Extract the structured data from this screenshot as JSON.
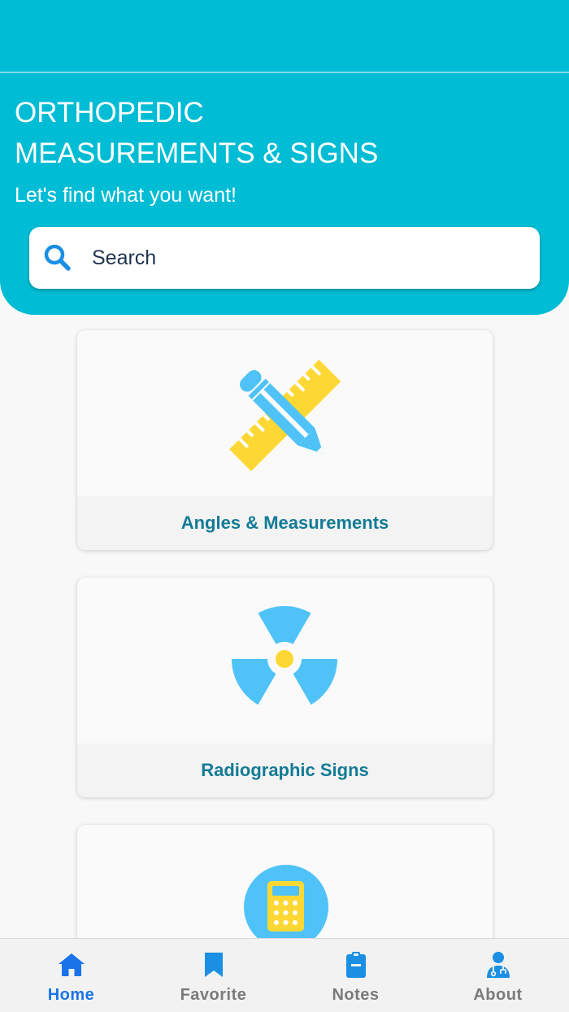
{
  "header": {
    "title_line1": "ORTHOPEDIC",
    "title_line2": "MEASUREMENTS & SIGNS",
    "subtitle": "Let's find what you want!"
  },
  "search": {
    "placeholder": "Search",
    "icon": "search-icon"
  },
  "cards": [
    {
      "label": "Angles & Measurements",
      "icon": "pencil-ruler-icon"
    },
    {
      "label": "Radiographic Signs",
      "icon": "radiation-icon"
    },
    {
      "label": "",
      "icon": "calculator-icon"
    }
  ],
  "nav": {
    "items": [
      {
        "label": "Home",
        "icon": "home-icon",
        "active": true
      },
      {
        "label": "Favorite",
        "icon": "bookmark-icon",
        "active": false
      },
      {
        "label": "Notes",
        "icon": "clipboard-icon",
        "active": false
      },
      {
        "label": "About",
        "icon": "doctor-icon",
        "active": false
      }
    ]
  },
  "colors": {
    "header_bg": "#00bcd4",
    "card_label": "#137b95",
    "nav_active": "#1a73e8",
    "nav_inactive": "#7a7a7a",
    "icon_blue": "#4fc3f7",
    "icon_yellow": "#fdd835"
  }
}
